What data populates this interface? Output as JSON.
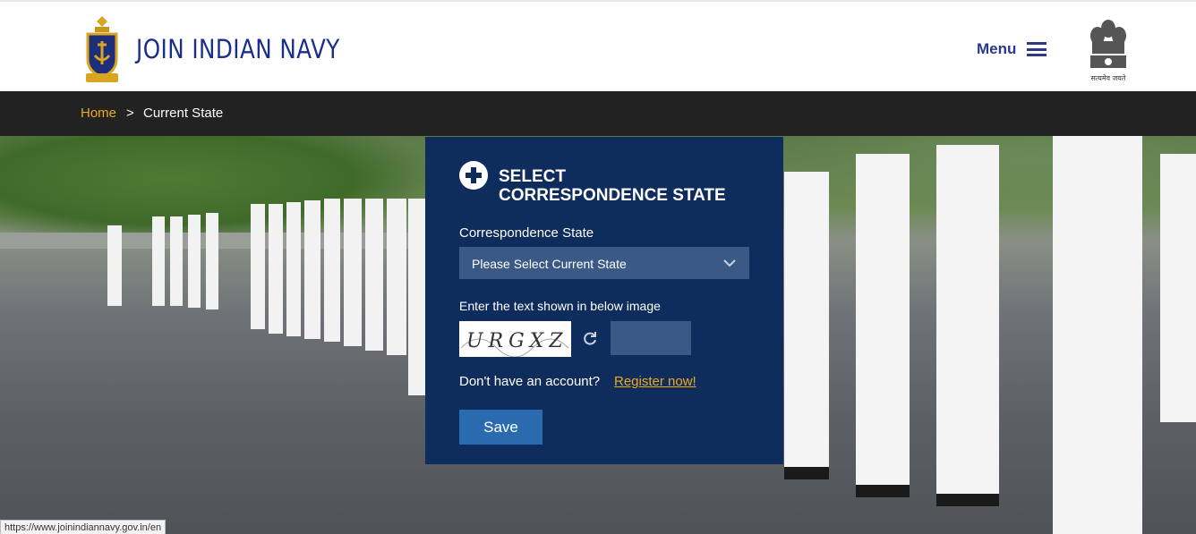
{
  "header": {
    "brand": "JOIN INDIAN NAVY",
    "menu_label": "Menu",
    "emblem_caption": "सत्यमेव जयते"
  },
  "breadcrumb": {
    "home": "Home",
    "separator": ">",
    "current": "Current State"
  },
  "panel": {
    "title_line1": "SELECT",
    "title_line2": "CORRESPONDENCE STATE",
    "state_label": "Correspondence State",
    "state_select_value": "Please Select Current State",
    "captcha_label": "Enter the text shown in below image",
    "captcha_text": "URGXZ",
    "captcha_input_value": "",
    "account_prompt": "Don't have an account?",
    "register_link": "Register now!",
    "save_label": "Save"
  },
  "status_bar": {
    "url": "https://www.joinindiannavy.gov.in/en"
  },
  "colors": {
    "brand_blue": "#1a2f8c",
    "panel_bg": "#0f2d5c",
    "accent_gold": "#f0a81c",
    "button_blue": "#2a6bb0",
    "crumb_bar": "#222222"
  },
  "icons": [
    "navy-crest-icon",
    "hamburger-icon",
    "national-emblem-icon",
    "plus-circle-icon",
    "chevron-down-icon",
    "refresh-icon"
  ]
}
